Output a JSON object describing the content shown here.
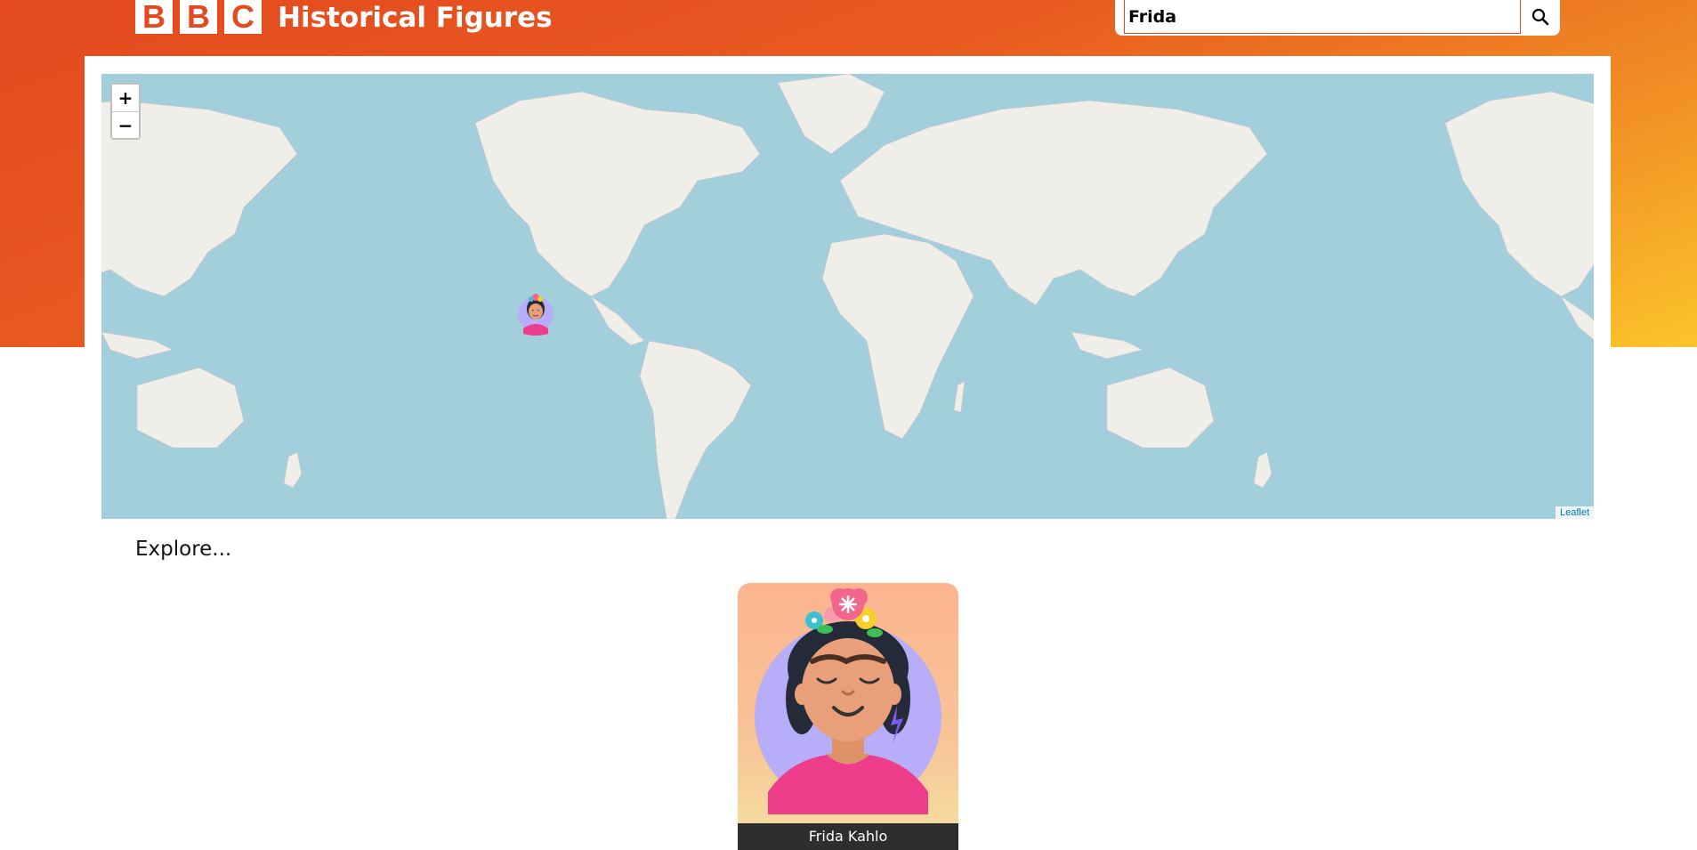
{
  "header": {
    "logo_letters": [
      "B",
      "B",
      "C"
    ],
    "title": "Historical Figures"
  },
  "search": {
    "value": "Frida",
    "button_icon": "search-icon"
  },
  "map": {
    "zoom_in_label": "+",
    "zoom_out_label": "−",
    "attribution": "Leaflet",
    "marker_icon": "frida-kahlo-avatar"
  },
  "explore": {
    "heading": "Explore...",
    "cards": [
      {
        "name": "Frida Kahlo",
        "image_icon": "frida-kahlo-portrait"
      }
    ]
  },
  "colors": {
    "brand": "#e4491f",
    "gradient_end": "#fbc42b",
    "ocean": "#a3cfdc",
    "land": "#efeee8",
    "card_label_bg": "#2e2e2e"
  }
}
